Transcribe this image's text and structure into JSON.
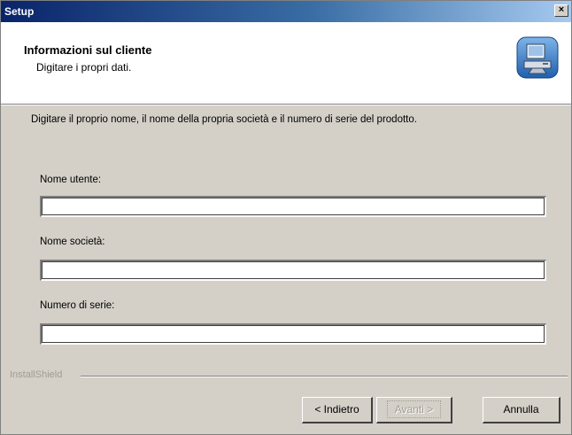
{
  "window": {
    "title": "Setup",
    "close_symbol": "×"
  },
  "header": {
    "title": "Informazioni sul cliente",
    "subtitle": "Digitare i propri dati.",
    "icon": "setup-computer-icon"
  },
  "body": {
    "instructions": "Digitare il proprio nome, il nome della propria società e il numero di serie del prodotto.",
    "fields": [
      {
        "label": "Nome utente:",
        "value": ""
      },
      {
        "label": "Nome società:",
        "value": ""
      },
      {
        "label": "Numero di serie:",
        "value": ""
      }
    ]
  },
  "footer": {
    "brand": "InstallShield",
    "back_label": "< Indietro",
    "next_label": "Avanti >",
    "cancel_label": "Annulla"
  }
}
